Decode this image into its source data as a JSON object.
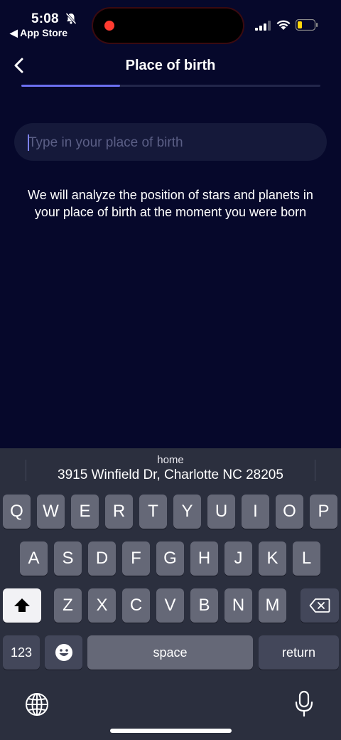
{
  "status_bar": {
    "time": "5:08",
    "back_app": "◀ App Store",
    "recording_color": "#ff3b30",
    "icons": [
      "bell-slash-icon",
      "cellular-signal-icon",
      "wifi-icon",
      "battery-icon"
    ]
  },
  "header": {
    "title": "Place of birth",
    "back_icon": "chevron-left-icon",
    "progress_fraction": 0.33
  },
  "search": {
    "value": "",
    "placeholder": "Type in your place of birth"
  },
  "description": "We will analyze the position of stars and planets in your place of birth at the moment you were born",
  "keyboard": {
    "suggestion": {
      "label": "home",
      "address": "3915 Winfield Dr, Charlotte NC 28205"
    },
    "row1": [
      "Q",
      "W",
      "E",
      "R",
      "T",
      "Y",
      "U",
      "I",
      "O",
      "P"
    ],
    "row2": [
      "A",
      "S",
      "D",
      "F",
      "G",
      "H",
      "J",
      "K",
      "L"
    ],
    "row3": [
      "Z",
      "X",
      "C",
      "V",
      "B",
      "N",
      "M"
    ],
    "numbers_label": "123",
    "space_label": "space",
    "return_label": "return",
    "icons": [
      "shift-icon",
      "backspace-icon",
      "emoji-icon",
      "globe-icon",
      "microphone-icon"
    ]
  },
  "colors": {
    "background": "#06082b",
    "accent": "#6b6ff0",
    "keyboard_bg": "#2b2f3e"
  }
}
